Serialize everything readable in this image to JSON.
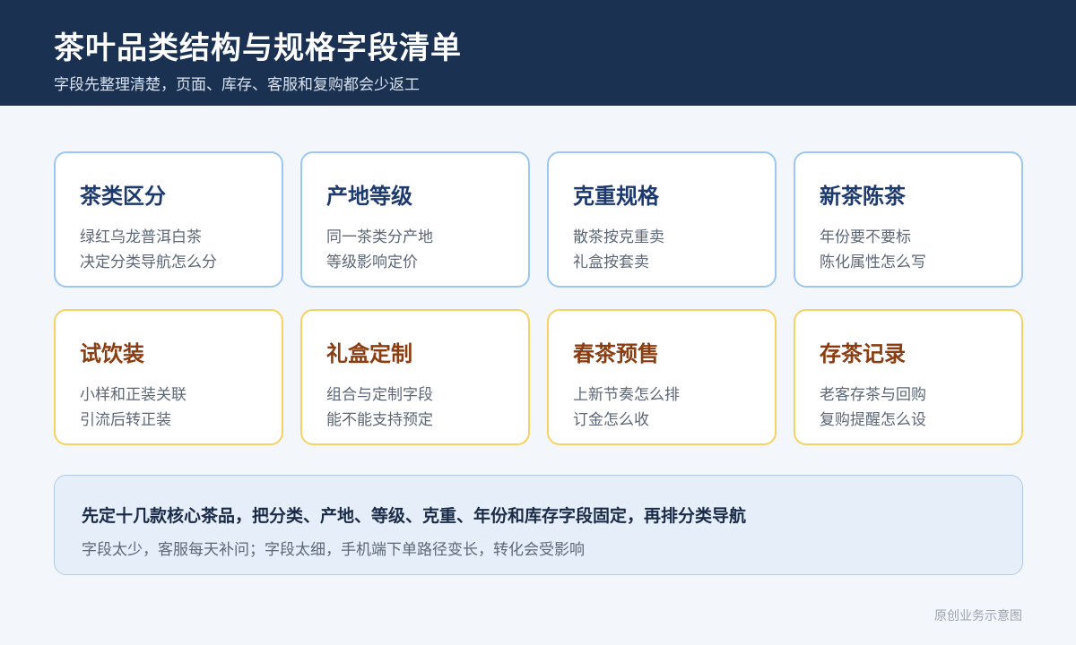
{
  "header": {
    "title": "茶叶品类结构与规格字段清单",
    "subtitle": "字段先整理清楚，页面、库存、客服和复购都会少返工"
  },
  "cards": [
    {
      "title": "茶类区分",
      "line1": "绿红乌龙普洱白茶",
      "line2": "决定分类导航怎么分"
    },
    {
      "title": "产地等级",
      "line1": "同一茶类分产地",
      "line2": "等级影响定价"
    },
    {
      "title": "克重规格",
      "line1": "散茶按克重卖",
      "line2": "礼盒按套卖"
    },
    {
      "title": "新茶陈茶",
      "line1": "年份要不要标",
      "line2": "陈化属性怎么写"
    },
    {
      "title": "试饮装",
      "line1": "小样和正装关联",
      "line2": "引流后转正装"
    },
    {
      "title": "礼盒定制",
      "line1": "组合与定制字段",
      "line2": "能不能支持预定"
    },
    {
      "title": "春茶预售",
      "line1": "上新节奏怎么排",
      "line2": "订金怎么收"
    },
    {
      "title": "存茶记录",
      "line1": "老客存茶与回购",
      "line2": "复购提醒怎么设"
    }
  ],
  "summary": {
    "main": "先定十几款核心茶品，把分类、产地、等级、克重、年份和库存字段固定，再排分类导航",
    "sub": "字段太少，客服每天补问；字段太细，手机端下单路径变长，转化会受影响"
  },
  "footer": {
    "note": "原创业务示意图"
  },
  "colors": {
    "header_bg": "#1a3152",
    "blue_border": "#9cc7f2",
    "yellow_border": "#f5d262",
    "blue_title": "#1d3a6e",
    "brown_title": "#8a3d10"
  }
}
